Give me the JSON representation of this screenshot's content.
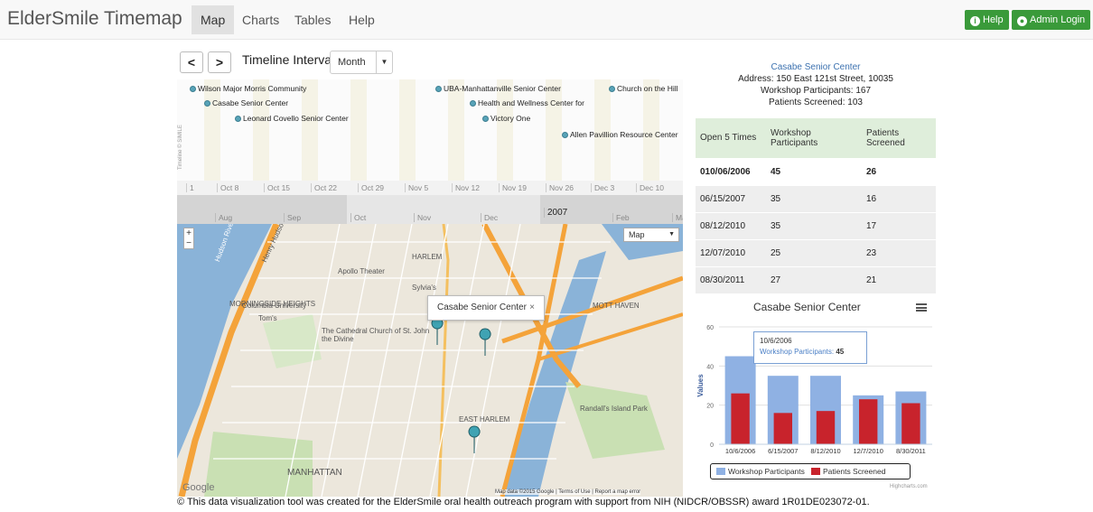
{
  "nav": {
    "brand": "ElderSmile Timemap",
    "items": [
      "Map",
      "Charts",
      "Tables",
      "Help"
    ],
    "help_button": "Help",
    "admin_button": "Admin Login"
  },
  "timeline_controls": {
    "prev": "<",
    "next": ">",
    "interval_label": "Timeline Interval:",
    "interval_value": "Month"
  },
  "timeline": {
    "events": [
      "Wilson Major Morris Community",
      "Casabe Senior Center",
      "Leonard Covello Senior Center",
      "UBA-Manhattanville Senior Center",
      "Health and Wellness Center for",
      "Victory One",
      "Church on the Hill",
      "Allen Pavillion Resource Center"
    ],
    "week_ticks": [
      "1",
      "Oct 8",
      "Oct 15",
      "Oct 22",
      "Oct 29",
      "Nov 5",
      "Nov 12",
      "Nov 19",
      "Nov 26",
      "Dec 3",
      "Dec 10"
    ],
    "month_ticks": [
      "Aug",
      "Sep",
      "Oct",
      "Nov",
      "Dec",
      "2007",
      "Feb",
      "Ma"
    ],
    "credit": "Timeline © SIMILE"
  },
  "map": {
    "zoom_in": "+",
    "zoom_out": "−",
    "map_type": "Map",
    "popup_text": "Casabe Senior Center",
    "popup_close": "×",
    "labels": [
      "HARLEM",
      "MORNINGSIDE HEIGHTS",
      "Columbia University",
      "Apollo Theater",
      "The Cathedral Church of St. John the Divine",
      "EAST HARLEM",
      "MANHATTAN",
      "MOTT HAVEN",
      "Randall's Island Park",
      "Henry Hudson Pkwy",
      "Hudson River",
      "Sylvia's",
      "Tom's"
    ],
    "attribution": "Map data ©2015 Google | Terms of Use | Report a map error",
    "google": "Google"
  },
  "footer": "© This data visualization tool was created for the ElderSmile oral health outreach program with support from NIH (NIDCR/OBSSR) award 1R01DE023072-01.",
  "center_info": {
    "name": "Casabe Senior Center",
    "address": "Address: 150 East 121st Street, 10035",
    "participants": "Workshop Participants: 167",
    "screened": "Patients Screened: 103"
  },
  "table": {
    "headers": [
      "Open 5 Times",
      "Workshop Participants",
      "Patients Screened"
    ],
    "rows": [
      [
        "010/06/2006",
        "45",
        "26"
      ],
      [
        "06/15/2007",
        "35",
        "16"
      ],
      [
        "08/12/2010",
        "35",
        "17"
      ],
      [
        "12/07/2010",
        "25",
        "23"
      ],
      [
        "08/30/2011",
        "27",
        "21"
      ]
    ]
  },
  "tooltip": {
    "date": "10/6/2006",
    "label": "Workshop Participants:",
    "value": "45"
  },
  "highcharts_credit": "Highcharts.com",
  "colors": {
    "workshop": "#8fb1e3",
    "screened": "#c8232c",
    "accent": "#3a9a3a"
  },
  "chart_data": {
    "type": "bar",
    "title": "Casabe Senior Center",
    "categories": [
      "10/6/2006",
      "6/15/2007",
      "8/12/2010",
      "12/7/2010",
      "8/30/2011"
    ],
    "series": [
      {
        "name": "Workshop Participants",
        "values": [
          45,
          35,
          35,
          25,
          27
        ]
      },
      {
        "name": "Patients Screened",
        "values": [
          26,
          16,
          17,
          23,
          21
        ]
      }
    ],
    "ylabel": "Values",
    "yticks": [
      0,
      20,
      40,
      60
    ],
    "ylim": [
      0,
      60
    ],
    "legend": "bottom"
  }
}
